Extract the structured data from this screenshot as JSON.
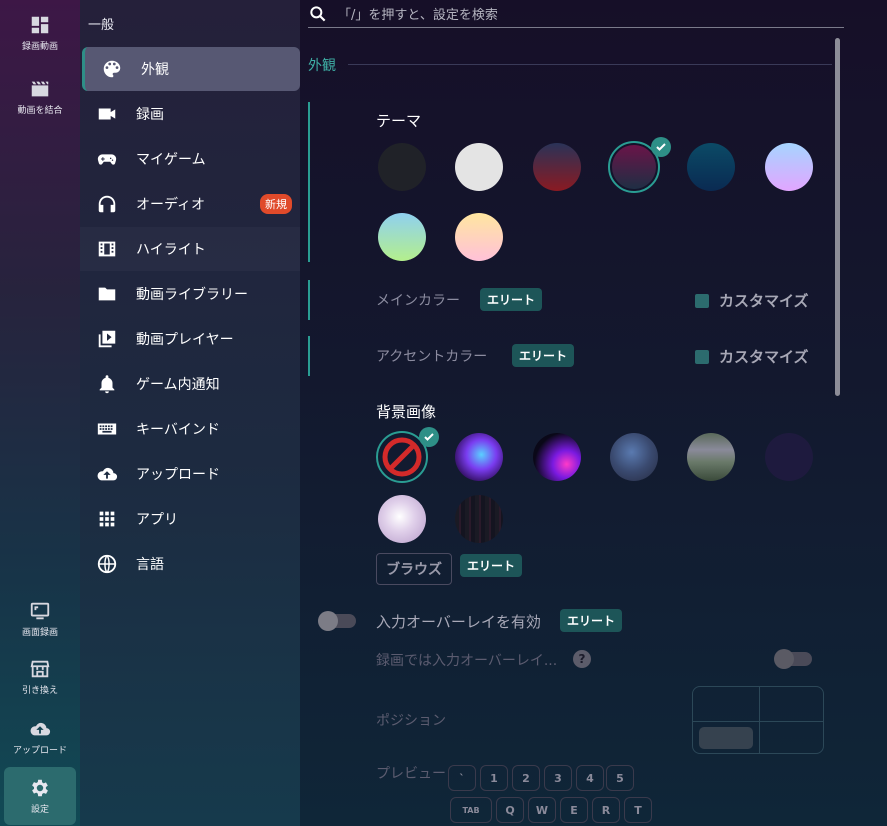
{
  "rail": {
    "top_items": [
      {
        "label": "録画動画",
        "icon": "dashboard-icon"
      },
      {
        "label": "動画を結合",
        "icon": "clapperboard-icon"
      }
    ],
    "bottom_items": [
      {
        "label": "画面録画",
        "icon": "monitor-icon"
      },
      {
        "label": "引き換え",
        "icon": "store-icon"
      },
      {
        "label": "アップロード",
        "icon": "cloud-upload-icon"
      },
      {
        "label": "設定",
        "icon": "gear-icon"
      }
    ]
  },
  "nav": {
    "header": "一般",
    "items": [
      {
        "label": "外観",
        "icon": "palette-icon"
      },
      {
        "label": "録画",
        "icon": "videocam-icon"
      },
      {
        "label": "マイゲーム",
        "icon": "gamepad-icon"
      },
      {
        "label": "オーディオ",
        "icon": "headphones-icon",
        "badge": "新規"
      },
      {
        "label": "ハイライト",
        "icon": "film-icon"
      },
      {
        "label": "動画ライブラリー",
        "icon": "folder-icon"
      },
      {
        "label": "動画プレイヤー",
        "icon": "video-library-icon"
      },
      {
        "label": "ゲーム内通知",
        "icon": "bell-icon"
      },
      {
        "label": "キーバインド",
        "icon": "keyboard-icon"
      },
      {
        "label": "アップロード",
        "icon": "cloud-upload-icon"
      },
      {
        "label": "アプリ",
        "icon": "apps-grid-icon"
      },
      {
        "label": "言語",
        "icon": "globe-icon"
      }
    ]
  },
  "search": {
    "placeholder": "「/」を押すと、設定を検索"
  },
  "section": {
    "title": "外観"
  },
  "theme": {
    "label": "テーマ",
    "selected_index": 3,
    "colors": [
      "#202228",
      "#e4e4e4",
      "#5a1c35",
      "#2a1a3a",
      "#0a3a5a",
      "#c9b8ff",
      "#9fe0c8",
      "#ffe5b0"
    ]
  },
  "main_color": {
    "label": "メインカラー",
    "badge": "エリート",
    "customize": "カスタマイズ"
  },
  "accent_color": {
    "label": "アクセントカラー",
    "badge": "エリート",
    "customize": "カスタマイズ"
  },
  "background": {
    "label": "背景画像",
    "browse": "ブラウズ",
    "badge": "エリート"
  },
  "overlay": {
    "label": "入力オーバーレイを有効",
    "badge": "エリート",
    "sub_label": "録画では入力オーバーレイ...",
    "help": "?",
    "position_label": "ポジション",
    "preview_label": "プレビュー",
    "keys_row1": [
      "`",
      "1",
      "2",
      "3",
      "4",
      "5"
    ],
    "keys_row2": [
      "TAB",
      "Q",
      "W",
      "E",
      "R",
      "T"
    ]
  }
}
